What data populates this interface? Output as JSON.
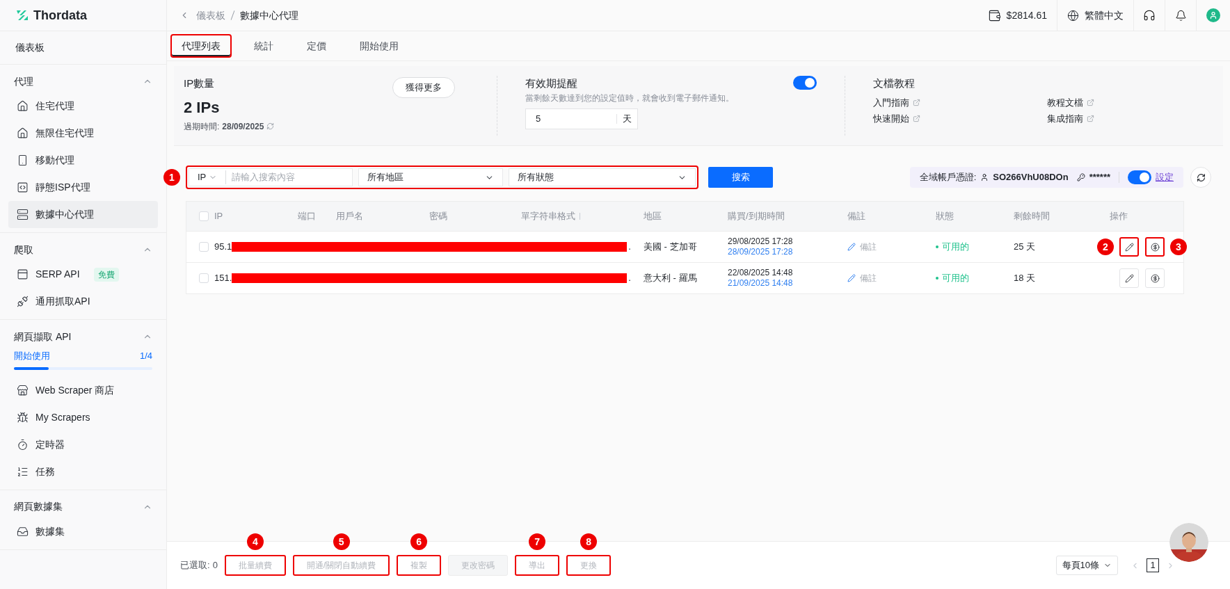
{
  "brand": {
    "name": "Thordata"
  },
  "sidebar": {
    "dashboard": {
      "label": "儀表板"
    },
    "sections": [
      {
        "title": "代理",
        "expanded": true,
        "items": [
          {
            "label": "住宅代理",
            "selected": false
          },
          {
            "label": "無限住宅代理",
            "selected": false
          },
          {
            "label": "移動代理",
            "selected": false
          },
          {
            "label": "靜態ISP代理",
            "selected": false
          },
          {
            "label": "數據中心代理",
            "selected": true
          }
        ]
      },
      {
        "title": "爬取",
        "expanded": true,
        "items": [
          {
            "label": "SERP API",
            "selected": false,
            "badge": "免費"
          },
          {
            "label": "通用抓取API",
            "selected": false
          }
        ]
      },
      {
        "title": "網頁擷取 API",
        "expanded": true,
        "progress": {
          "label": "開始使用",
          "count": "1/4",
          "level": 0.25
        },
        "items": [
          {
            "label": "Web Scraper 商店",
            "selected": false
          },
          {
            "label": "My Scrapers",
            "selected": false
          },
          {
            "label": "定時器",
            "selected": false
          },
          {
            "label": "任務",
            "selected": false
          }
        ]
      },
      {
        "title": "網頁數據集",
        "expanded": true,
        "items": [
          {
            "label": "數據集",
            "selected": false
          }
        ]
      }
    ]
  },
  "header": {
    "breadcrumb": [
      "儀表板",
      "數據中心代理"
    ],
    "balance": "$2814.61",
    "language": "繁體中文"
  },
  "tabs": [
    {
      "label": "代理列表",
      "selected": true,
      "highlighted": true
    },
    {
      "label": "統計",
      "selected": false,
      "highlighted": false
    },
    {
      "label": "定價",
      "selected": false,
      "highlighted": false
    },
    {
      "label": "開始使用",
      "selected": false,
      "highlighted": false
    }
  ],
  "summary": {
    "ip_count": {
      "label": "IP數量",
      "value": "2 IPs",
      "expiry_label": "過期時間:",
      "expiry": "28/09/2025",
      "button": "獲得更多"
    },
    "reminder": {
      "title": "有效期提醒",
      "description": "當剩餘天數達到您的設定值時，就會收到電子郵件通知。",
      "on": true,
      "value": "5",
      "unit": "天"
    },
    "docs": {
      "title": "文檔教程",
      "links": [
        "入門指南",
        "教程文檔",
        "快速開始",
        "集成指南"
      ]
    }
  },
  "filters": {
    "highlighted": true,
    "callout": "1",
    "type": "IP",
    "placeholder": "請輸入搜索內容",
    "region": "所有地區",
    "status": "所有狀態",
    "search_button": "搜索"
  },
  "credentials": {
    "label": "全域帳戶憑證:",
    "username": "SO266VhU08DOn",
    "password": "******",
    "on": true,
    "link": "設定"
  },
  "table": {
    "all_checked": false,
    "columns": [
      "IP",
      "端口",
      "用戶名",
      "密碼",
      "單字符串格式",
      "地區",
      "購買/到期時間",
      "備註",
      "狀態",
      "剩餘時間",
      "操作"
    ],
    "rows": [
      {
        "checked": false,
        "ip": "95.1",
        "redacted": true,
        "tail": ".",
        "region": "美國 - 芝加哥",
        "purchased": "29/08/2025 17:28",
        "expires": "28/09/2025 17:28",
        "note": "備註",
        "status": "可用的",
        "remaining": "25 天",
        "actions": [
          {
            "kind": "edit",
            "highlighted": true,
            "callout": "2"
          },
          {
            "kind": "renew",
            "highlighted": true,
            "callout": "3"
          }
        ]
      },
      {
        "checked": false,
        "ip": "151.",
        "redacted": true,
        "tail": ".",
        "region": "意大利 - 羅馬",
        "purchased": "22/08/2025 14:48",
        "expires": "21/09/2025 14:48",
        "note": "備註",
        "status": "可用的",
        "remaining": "18 天",
        "actions": [
          {
            "kind": "edit",
            "highlighted": false
          },
          {
            "kind": "renew",
            "highlighted": false
          }
        ]
      }
    ]
  },
  "footer": {
    "selected_label": "已選取:",
    "selected_count": "0",
    "buttons": [
      {
        "label": "批量續費",
        "disabled": true,
        "highlighted": true,
        "callout": "4"
      },
      {
        "label": "開通/關閉自動續費",
        "disabled": true,
        "highlighted": true,
        "callout": "5"
      },
      {
        "label": "複製",
        "disabled": true,
        "highlighted": true,
        "callout": "6"
      },
      {
        "label": "更改密碼",
        "disabled": true,
        "highlighted": false
      },
      {
        "label": "導出",
        "disabled": true,
        "highlighted": true,
        "callout": "7"
      },
      {
        "label": "更換",
        "disabled": true,
        "highlighted": true,
        "callout": "8"
      }
    ],
    "page_size": "每頁10條",
    "pages": [
      {
        "label": "1",
        "selected": true
      }
    ]
  }
}
